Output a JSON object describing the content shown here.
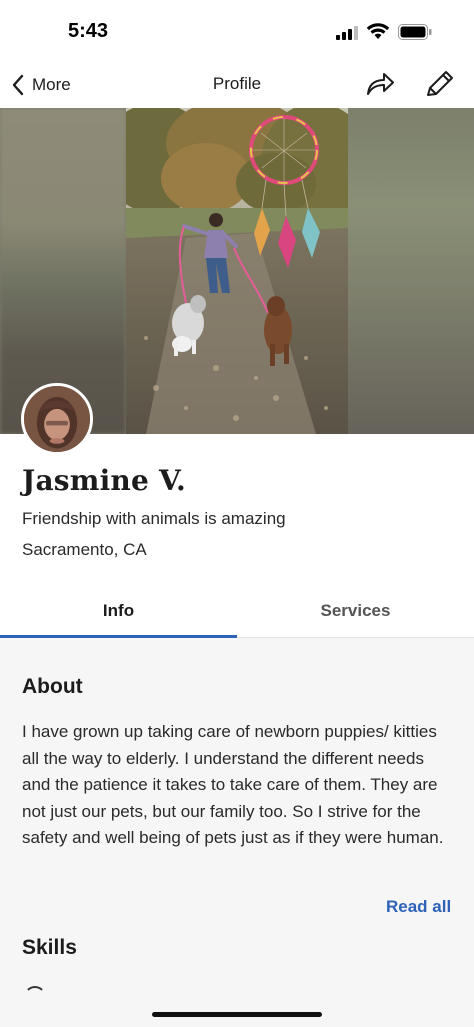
{
  "status_bar": {
    "time": "5:43"
  },
  "nav": {
    "back_label": "More",
    "title": "Profile",
    "icons": [
      "chevron-left-icon",
      "share-icon",
      "pencil-icon"
    ]
  },
  "profile": {
    "name": "Jasmine V.",
    "tagline": "Friendship with animals is amazing",
    "location": "Sacramento, CA"
  },
  "tabs": [
    {
      "label": "Info",
      "active": true
    },
    {
      "label": "Services",
      "active": false
    }
  ],
  "about": {
    "title": "About",
    "text": "I have grown up taking care of newborn puppies/ kitties all the way to elderly. I understand the different needs and the patience it takes to take care of them. They are not just our pets, but our family too. So I strive for the safety and well being of pets just as if they were human.",
    "read_all_label": "Read all"
  },
  "skills": {
    "title": "Skills"
  },
  "colors": {
    "accent": "#2e63b8",
    "background": "#f6f6f6"
  }
}
